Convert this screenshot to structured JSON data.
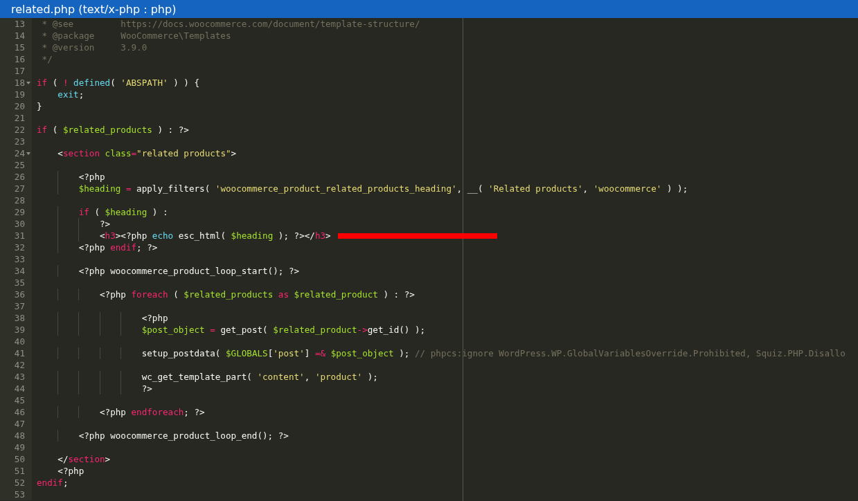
{
  "window": {
    "title": "related.php (text/x-php : php)"
  },
  "lines": [
    {
      "number": "13",
      "tokens": [
        {
          "kind": "comment",
          "text": " * @see         https://docs.woocommerce.com/document/template-structure/"
        }
      ]
    },
    {
      "number": "14",
      "tokens": [
        {
          "kind": "comment",
          "text": " * @package     WooCommerce\\Templates"
        }
      ]
    },
    {
      "number": "15",
      "tokens": [
        {
          "kind": "comment",
          "text": " * @version     3.9.0"
        }
      ]
    },
    {
      "number": "16",
      "tokens": [
        {
          "kind": "comment",
          "text": " */"
        }
      ]
    },
    {
      "number": "17"
    },
    {
      "number": "18",
      "foldable": true,
      "tokens": [
        {
          "kind": "keyword",
          "text": "if"
        },
        {
          "kind": "plain",
          "text": " ( "
        },
        {
          "kind": "keyword",
          "text": "!"
        },
        {
          "kind": "builtin",
          "text": " defined"
        },
        {
          "kind": "plain",
          "text": "( "
        },
        {
          "kind": "string",
          "text": "'ABSPATH'"
        },
        {
          "kind": "plain",
          "text": " ) ) {"
        }
      ]
    },
    {
      "number": "19",
      "tokens": [
        {
          "kind": "builtin",
          "text": "    exit"
        },
        {
          "kind": "plain",
          "text": ";"
        }
      ]
    },
    {
      "number": "20",
      "tokens": [
        {
          "kind": "plain",
          "text": "}"
        }
      ]
    },
    {
      "number": "21"
    },
    {
      "number": "22",
      "tokens": [
        {
          "kind": "keyword",
          "text": "if"
        },
        {
          "kind": "plain",
          "text": " ( "
        },
        {
          "kind": "variable",
          "text": "$related_products"
        },
        {
          "kind": "plain",
          "text": " ) : ?>"
        }
      ]
    },
    {
      "number": "23"
    },
    {
      "number": "24",
      "foldable": true,
      "tokens": [
        {
          "kind": "plain",
          "text": "    <"
        },
        {
          "kind": "tag",
          "text": "section"
        },
        {
          "kind": "attribute",
          "text": " class"
        },
        {
          "kind": "keyword",
          "text": "="
        },
        {
          "kind": "string",
          "text": "\"related products\""
        },
        {
          "kind": "plain",
          "text": ">"
        }
      ]
    },
    {
      "number": "25"
    },
    {
      "number": "26",
      "tokens": [
        {
          "kind": "plain",
          "text": "        <?php"
        }
      ]
    },
    {
      "number": "27",
      "tokens": [
        {
          "kind": "variable",
          "text": "        $heading"
        },
        {
          "kind": "keyword",
          "text": " ="
        },
        {
          "kind": "plain",
          "text": " apply_filters( "
        },
        {
          "kind": "string",
          "text": "'woocommerce_product_related_products_heading'"
        },
        {
          "kind": "plain",
          "text": ", __( "
        },
        {
          "kind": "string",
          "text": "'Related products'"
        },
        {
          "kind": "plain",
          "text": ", "
        },
        {
          "kind": "string",
          "text": "'woocommerce'"
        },
        {
          "kind": "plain",
          "text": " ) );"
        }
      ]
    },
    {
      "number": "28"
    },
    {
      "number": "29",
      "tokens": [
        {
          "kind": "keyword",
          "text": "        if"
        },
        {
          "kind": "plain",
          "text": " ( "
        },
        {
          "kind": "variable",
          "text": "$heading"
        },
        {
          "kind": "plain",
          "text": " ) :"
        }
      ]
    },
    {
      "number": "30",
      "tokens": [
        {
          "kind": "plain",
          "text": "            ?>"
        }
      ]
    },
    {
      "number": "31",
      "marker": true,
      "tokens": [
        {
          "kind": "plain",
          "text": "            <"
        },
        {
          "kind": "tag",
          "text": "h3"
        },
        {
          "kind": "plain",
          "text": "><?php "
        },
        {
          "kind": "builtin",
          "text": "echo"
        },
        {
          "kind": "plain",
          "text": " esc_html( "
        },
        {
          "kind": "variable",
          "text": "$heading"
        },
        {
          "kind": "plain",
          "text": " ); ?></"
        },
        {
          "kind": "tag",
          "text": "h3"
        },
        {
          "kind": "plain",
          "text": ">"
        }
      ]
    },
    {
      "number": "32",
      "tokens": [
        {
          "kind": "plain",
          "text": "        <?php "
        },
        {
          "kind": "keyword",
          "text": "endif"
        },
        {
          "kind": "plain",
          "text": "; ?>"
        }
      ]
    },
    {
      "number": "33"
    },
    {
      "number": "34",
      "tokens": [
        {
          "kind": "plain",
          "text": "        <?php woocommerce_product_loop_start(); ?>"
        }
      ]
    },
    {
      "number": "35"
    },
    {
      "number": "36",
      "tokens": [
        {
          "kind": "plain",
          "text": "            <?php "
        },
        {
          "kind": "keyword",
          "text": "foreach"
        },
        {
          "kind": "plain",
          "text": " ( "
        },
        {
          "kind": "variable",
          "text": "$related_products"
        },
        {
          "kind": "keyword",
          "text": " as"
        },
        {
          "kind": "variable",
          "text": " $related_product"
        },
        {
          "kind": "plain",
          "text": " ) : ?>"
        }
      ]
    },
    {
      "number": "37"
    },
    {
      "number": "38",
      "tokens": [
        {
          "kind": "plain",
          "text": "                    <?php"
        }
      ]
    },
    {
      "number": "39",
      "tokens": [
        {
          "kind": "variable",
          "text": "                    $post_object"
        },
        {
          "kind": "keyword",
          "text": " ="
        },
        {
          "kind": "plain",
          "text": " get_post( "
        },
        {
          "kind": "variable",
          "text": "$related_product"
        },
        {
          "kind": "keyword",
          "text": "->"
        },
        {
          "kind": "plain",
          "text": "get_id() );"
        }
      ]
    },
    {
      "number": "40"
    },
    {
      "number": "41",
      "tokens": [
        {
          "kind": "plain",
          "text": "                    setup_postdata( "
        },
        {
          "kind": "variable",
          "text": "$GLOBALS"
        },
        {
          "kind": "plain",
          "text": "["
        },
        {
          "kind": "string",
          "text": "'post'"
        },
        {
          "kind": "plain",
          "text": "] "
        },
        {
          "kind": "keyword",
          "text": "=&"
        },
        {
          "kind": "variable",
          "text": " $post_object"
        },
        {
          "kind": "plain",
          "text": " ); "
        },
        {
          "kind": "comment",
          "text": "// phpcs:ignore WordPress.WP.GlobalVariablesOverride.Prohibited, Squiz.PHP.Disallo"
        }
      ]
    },
    {
      "number": "42"
    },
    {
      "number": "43",
      "tokens": [
        {
          "kind": "plain",
          "text": "                    wc_get_template_part( "
        },
        {
          "kind": "string",
          "text": "'content'"
        },
        {
          "kind": "plain",
          "text": ", "
        },
        {
          "kind": "string",
          "text": "'product'"
        },
        {
          "kind": "plain",
          "text": " );"
        }
      ]
    },
    {
      "number": "44",
      "tokens": [
        {
          "kind": "plain",
          "text": "                    ?>"
        }
      ]
    },
    {
      "number": "45"
    },
    {
      "number": "46",
      "tokens": [
        {
          "kind": "plain",
          "text": "            <?php "
        },
        {
          "kind": "keyword",
          "text": "endforeach"
        },
        {
          "kind": "plain",
          "text": "; ?>"
        }
      ]
    },
    {
      "number": "47"
    },
    {
      "number": "48",
      "tokens": [
        {
          "kind": "plain",
          "text": "        <?php woocommerce_product_loop_end(); ?>"
        }
      ]
    },
    {
      "number": "49"
    },
    {
      "number": "50",
      "tokens": [
        {
          "kind": "plain",
          "text": "    </"
        },
        {
          "kind": "tag",
          "text": "section"
        },
        {
          "kind": "plain",
          "text": ">"
        }
      ]
    },
    {
      "number": "51",
      "tokens": [
        {
          "kind": "plain",
          "text": "    <?php"
        }
      ]
    },
    {
      "number": "52",
      "tokens": [
        {
          "kind": "keyword",
          "text": "endif"
        },
        {
          "kind": "plain",
          "text": ";"
        }
      ]
    },
    {
      "number": "53"
    }
  ]
}
